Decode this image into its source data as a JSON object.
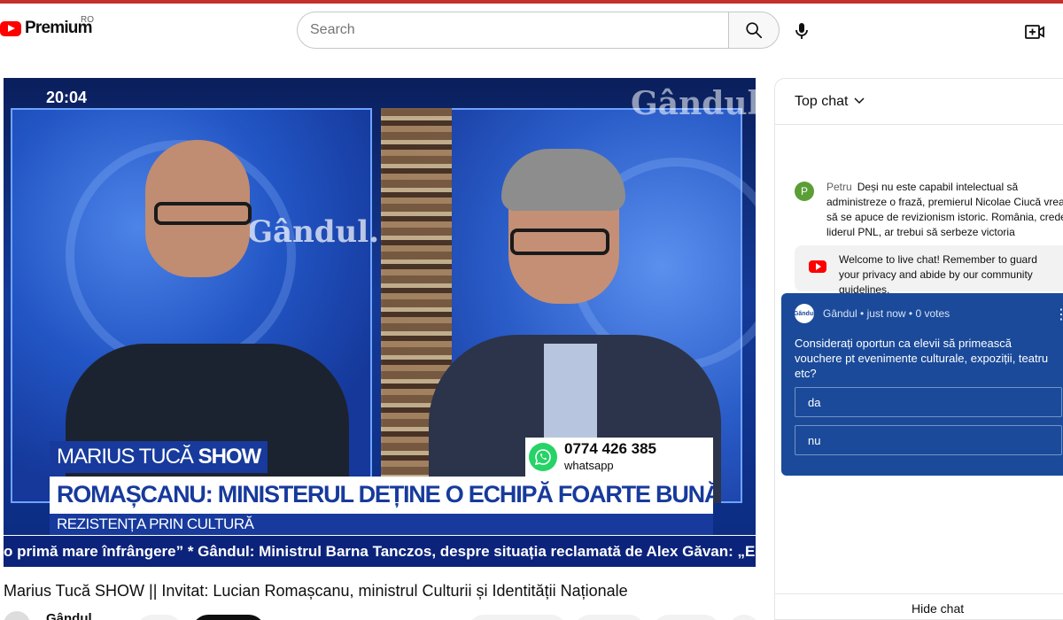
{
  "header": {
    "logo_text": "Premium",
    "country_code": "RO",
    "search_placeholder": "Search"
  },
  "video": {
    "clock": "20:04",
    "brand_watermark": "Gândul",
    "set_watermark": "Gândul.",
    "show_name_regular": "MARIUS TUCĂ ",
    "show_name_bold": "SHOW",
    "contact_phone": "0774 426 385",
    "contact_label": "whatsapp",
    "headline": "ROMAȘCANU: MINISTERUL DEȚINE O ECHIPĂ FOARTE BUNĂ",
    "subheadline": "REZISTENȚA PRIN CULTURĂ",
    "ticker": "o primă mare înfrângere” * Gândul: Ministrul Barna Tanczos, despre situația reclamată de Alex Găvan: „Este inadm",
    "title": "Marius Tucă SHOW || Invitat: Lucian Romașcanu, ministrul Culturii și Identității Naționale"
  },
  "channel": {
    "name": "Gândul"
  },
  "chat": {
    "mode_label": "Top chat",
    "messages": [
      {
        "avatar_letter": "P",
        "author": "Petru",
        "text": "Deși nu este capabil intelectual să administreze o frază, premierul Nicolae Ciucă vrea să se apuce de revizionism istoric. România, crede liderul PNL, ar trebui să serbeze victoria",
        "avatar_color": "#5c9e36"
      }
    ],
    "welcome_text": "Welcome to live chat! Remember to guard your privacy and abide by our community guidelines.",
    "poll": {
      "avatar_text": "Gândul",
      "meta": "Gândul • just now • 0 votes",
      "question": "Considerați oportun ca elevii să primească vouchere pt evenimente culturale, expoziții, teatru etc?",
      "options": [
        "da",
        "nu"
      ]
    },
    "hide_label": "Hide chat"
  },
  "colors": {
    "brand_red": "#ff0000",
    "poll_bg": "#1b4a9a",
    "lower_third_blue": "#173a9c",
    "whatsapp_green": "#25d366"
  }
}
